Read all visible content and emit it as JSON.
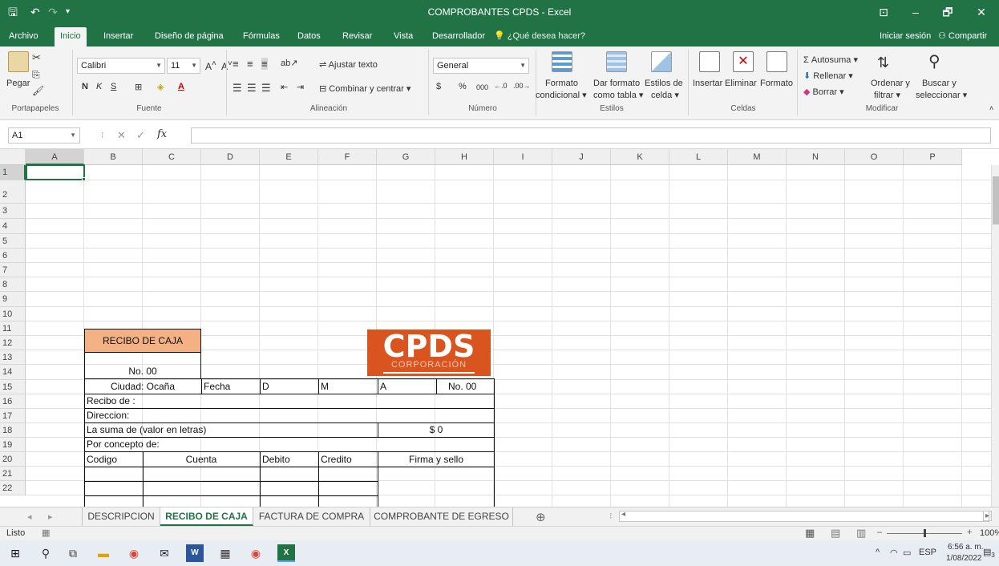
{
  "window": {
    "title": "COMPROBANTES CPDS - Excel",
    "minimize": "–",
    "restore": "🗗",
    "close": "✕",
    "ribbon_display": "⊡"
  },
  "ribbon_tabs": [
    "Archivo",
    "Inicio",
    "Insertar",
    "Diseño de página",
    "Fórmulas",
    "Datos",
    "Revisar",
    "Vista",
    "Desarrollador"
  ],
  "tell_me": "¿Qué desea hacer?",
  "signin": "Iniciar sesión",
  "share": "Compartir",
  "ribbon": {
    "clipboard": {
      "paste": "Pegar",
      "label": "Portapapeles"
    },
    "font": {
      "name": "Calibri",
      "size": "11",
      "bold": "N",
      "italic": "K",
      "underline": "S",
      "label": "Fuente"
    },
    "alignment": {
      "wrap": "Ajustar texto",
      "merge": "Combinar y centrar",
      "label": "Alineación"
    },
    "number": {
      "format": "General",
      "currency": "$",
      "percent": "%",
      "thousands": "000",
      "label": "Número"
    },
    "styles": {
      "conditional": "Formato",
      "conditional2": "condicional",
      "as_table": "Dar formato",
      "as_table2": "como tabla",
      "cell_styles": "Estilos de",
      "cell_styles2": "celda",
      "label": "Estilos"
    },
    "cells": {
      "insert": "Insertar",
      "delete": "Eliminar",
      "format": "Formato",
      "label": "Celdas"
    },
    "editing": {
      "autosum": "Autosuma",
      "fill": "Rellenar",
      "clear": "Borrar",
      "sort": "Ordenar y",
      "sort2": "filtrar",
      "find": "Buscar y",
      "find2": "seleccionar",
      "label": "Modificar"
    }
  },
  "formula_bar": {
    "name_box": "A1",
    "fx": "fx",
    "value": ""
  },
  "columns": [
    "A",
    "B",
    "C",
    "D",
    "E",
    "F",
    "G",
    "H",
    "I",
    "J",
    "K",
    "L",
    "M",
    "N",
    "O",
    "P"
  ],
  "rows": [
    "1",
    "2",
    "3",
    "4",
    "5",
    "6",
    "7",
    "8",
    "9",
    "10",
    "11",
    "12",
    "13",
    "14",
    "15",
    "16",
    "17",
    "18",
    "19",
    "20",
    "21",
    "22"
  ],
  "form": {
    "header": "RECIBO DE CAJA",
    "number": "No. 00",
    "logo_main": "CPDS",
    "logo_sub": "CORPORACIÓN",
    "city": "Ciudad: Ocaña",
    "date": "Fecha",
    "d": "D",
    "m": "M",
    "a": "A",
    "number2": "No. 00",
    "received_from": "Recibo de :",
    "address": "Direccion:",
    "sum_words": "La suma de (valor en letras)",
    "amount": "$ 0",
    "concept": "Por concepto de:",
    "code": "Codigo",
    "account": "Cuenta",
    "debit": "Debito",
    "credit": "Credito",
    "signature": "Firma y sello"
  },
  "sheet_tabs": [
    "DESCRIPCION",
    "RECIBO DE CAJA",
    "FACTURA DE COMPRA",
    "COMPROBANTE DE EGRESO"
  ],
  "active_sheet": "RECIBO DE CAJA",
  "status": {
    "ready": "Listo",
    "zoom": "100%"
  },
  "taskbar": {
    "language": "ESP",
    "time": "6:56 a. m.",
    "date": "1/08/2022",
    "notifications": "3"
  },
  "colors": {
    "excel_green": "#217346",
    "header_fill": "#f4b183",
    "logo_bg": "#d9541e"
  }
}
